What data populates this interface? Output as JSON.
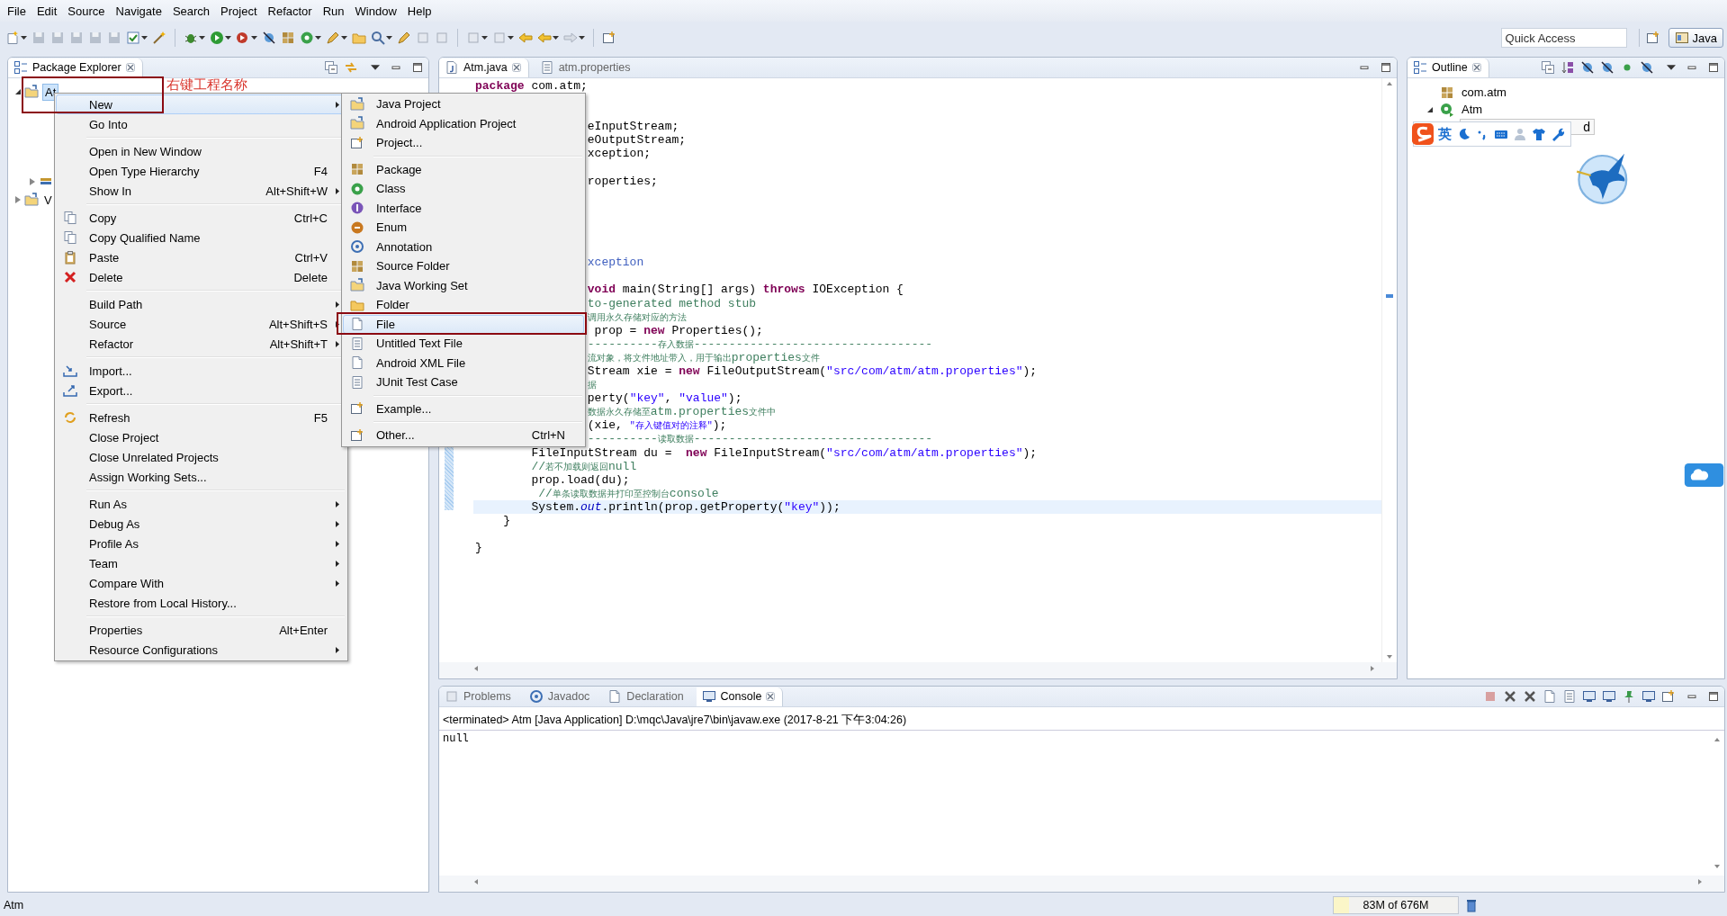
{
  "menubar": [
    "File",
    "Edit",
    "Source",
    "Navigate",
    "Search",
    "Project",
    "Refactor",
    "Run",
    "Window",
    "Help"
  ],
  "toolbar": {
    "quick_access": {
      "placeholder": "Quick Access"
    },
    "perspective": {
      "label": "Java",
      "selected": true
    }
  },
  "package_explorer": {
    "tab": {
      "label": "Package Explorer",
      "selected": true
    },
    "tree": [
      {
        "label": "At",
        "expanded": true,
        "selected": true,
        "children": [
          {
            "kind": "covered"
          },
          {
            "kind": "covered"
          },
          {
            "kind": "covered"
          },
          {
            "kind": "covered"
          },
          {
            "kind": "stub",
            "expanded": false
          }
        ]
      },
      {
        "label": "V",
        "expanded": false,
        "selected": false
      }
    ]
  },
  "editor": {
    "tabs": [
      {
        "label": "Atm.java",
        "selected": true,
        "closable": true
      },
      {
        "label": "atm.properties",
        "selected": false,
        "closable": false
      }
    ],
    "lines": [
      {
        "kind": "full",
        "current": false,
        "tokens": [
          {
            "kind": "kw",
            "text": "package"
          },
          {
            "kind": "p",
            "text": " com.atm;"
          }
        ]
      },
      {
        "kind": "blank",
        "current": false
      },
      {
        "kind": "blank",
        "current": false
      },
      {
        "kind": "partial",
        "current": false,
        "tokens": [
          {
            "kind": "p",
            "text": "eInputStream;"
          }
        ]
      },
      {
        "kind": "partial",
        "current": false,
        "tokens": [
          {
            "kind": "p",
            "text": "eOutputStream;"
          }
        ]
      },
      {
        "kind": "partial",
        "current": false,
        "tokens": [
          {
            "kind": "p",
            "text": "xception;"
          }
        ]
      },
      {
        "kind": "blank",
        "current": false
      },
      {
        "kind": "partial",
        "current": false,
        "tokens": [
          {
            "kind": "p",
            "text": "roperties;"
          }
        ]
      },
      {
        "kind": "blank",
        "current": false
      },
      {
        "kind": "blank",
        "current": false
      },
      {
        "kind": "blank",
        "current": false
      },
      {
        "kind": "blank",
        "current": false
      },
      {
        "kind": "blank",
        "current": false
      },
      {
        "kind": "partial",
        "current": false,
        "tokens": [
          {
            "kind": "doc",
            "text": "xception"
          }
        ]
      },
      {
        "kind": "blank",
        "current": false
      },
      {
        "kind": "partial",
        "current": false,
        "tokens": [
          {
            "kind": "kw",
            "text": "void"
          },
          {
            "kind": "p",
            "text": " main(String[] args) "
          },
          {
            "kind": "kw",
            "text": "throws"
          },
          {
            "kind": "p",
            "text": " IOException {"
          }
        ]
      },
      {
        "kind": "partial",
        "current": false,
        "tokens": [
          {
            "kind": "c",
            "text": "to-generated method stub"
          }
        ]
      },
      {
        "kind": "partial",
        "current": false,
        "tokens": [
          {
            "kind": "cs",
            "text": "调用永久存储对应的方法"
          }
        ]
      },
      {
        "kind": "partial",
        "current": false,
        "tokens": [
          {
            "kind": "p",
            "text": " prop = "
          },
          {
            "kind": "kw",
            "text": "new"
          },
          {
            "kind": "p",
            "text": " Properties();"
          }
        ]
      },
      {
        "kind": "partial",
        "current": false,
        "tokens": [
          {
            "kind": "c",
            "text": "----------"
          },
          {
            "kind": "cs",
            "text": "存入数据"
          },
          {
            "kind": "c",
            "text": "----------------------------------"
          }
        ]
      },
      {
        "kind": "partial",
        "current": false,
        "tokens": [
          {
            "kind": "cs",
            "text": "流对象，将文件地址带入，用于输出"
          },
          {
            "kind": "c",
            "text": "properties"
          },
          {
            "kind": "cs",
            "text": "文件"
          }
        ]
      },
      {
        "kind": "partial",
        "current": false,
        "tokens": [
          {
            "kind": "p",
            "text": "Stream xie = "
          },
          {
            "kind": "kw",
            "text": "new"
          },
          {
            "kind": "p",
            "text": " FileOutputStream("
          },
          {
            "kind": "s",
            "text": "\"src/com/atm/atm.properties\""
          },
          {
            "kind": "p",
            "text": ");"
          }
        ]
      },
      {
        "kind": "partial",
        "current": false,
        "tokens": [
          {
            "kind": "cs",
            "text": "据"
          }
        ]
      },
      {
        "kind": "partial",
        "current": false,
        "tokens": [
          {
            "kind": "p",
            "text": "perty("
          },
          {
            "kind": "s",
            "text": "\"key\""
          },
          {
            "kind": "p",
            "text": ", "
          },
          {
            "kind": "s",
            "text": "\"value\""
          },
          {
            "kind": "p",
            "text": ");"
          }
        ]
      },
      {
        "kind": "partial",
        "current": false,
        "tokens": [
          {
            "kind": "cs",
            "text": "数据永久存储至"
          },
          {
            "kind": "c",
            "text": "atm.properties"
          },
          {
            "kind": "cs",
            "text": "文件中"
          }
        ]
      },
      {
        "kind": "partial",
        "current": false,
        "tokens": [
          {
            "kind": "p",
            "text": "(xie, "
          },
          {
            "kind": "ss",
            "text": "\"存入键值对的注释\""
          },
          {
            "kind": "p",
            "text": ");"
          }
        ]
      },
      {
        "kind": "partial",
        "current": false,
        "tokens": [
          {
            "kind": "c",
            "text": "----------"
          },
          {
            "kind": "cs",
            "text": "读取数据"
          },
          {
            "kind": "c",
            "text": "----------------------------------"
          }
        ]
      },
      {
        "kind": "full",
        "current": false,
        "tokens": [
          {
            "kind": "p",
            "text": "        FileInputStream du =  "
          },
          {
            "kind": "kw",
            "text": "new"
          },
          {
            "kind": "p",
            "text": " FileInputStream("
          },
          {
            "kind": "s",
            "text": "\"src/com/atm/atm.properties\""
          },
          {
            "kind": "p",
            "text": ");"
          }
        ]
      },
      {
        "kind": "full",
        "current": false,
        "tokens": [
          {
            "kind": "c",
            "text": "        //"
          },
          {
            "kind": "cs",
            "text": "若不加载则返回"
          },
          {
            "kind": "c",
            "text": "null"
          }
        ]
      },
      {
        "kind": "full",
        "current": false,
        "tokens": [
          {
            "kind": "p",
            "text": "        prop.load(du);"
          }
        ]
      },
      {
        "kind": "full",
        "current": false,
        "tokens": [
          {
            "kind": "c",
            "text": "         //"
          },
          {
            "kind": "cs",
            "text": "单条读取数据并打印至控制台"
          },
          {
            "kind": "c",
            "text": "console"
          }
        ]
      },
      {
        "kind": "full",
        "current": true,
        "tokens": [
          {
            "kind": "p",
            "text": "        System."
          },
          {
            "kind": "f",
            "text": "out"
          },
          {
            "kind": "p",
            "text": ".println(prop.getProperty("
          },
          {
            "kind": "s",
            "text": "\"key\""
          },
          {
            "kind": "p",
            "text": "));"
          }
        ]
      },
      {
        "kind": "full",
        "current": false,
        "tokens": [
          {
            "kind": "p",
            "text": "    }"
          }
        ]
      },
      {
        "kind": "blank",
        "current": false
      },
      {
        "kind": "full",
        "current": false,
        "tokens": [
          {
            "kind": "p",
            "text": "}"
          }
        ]
      }
    ]
  },
  "outline": {
    "tab": {
      "label": "Outline",
      "selected": true
    },
    "items": [
      {
        "label": "com.atm",
        "expanded": false
      },
      {
        "label": "Atm",
        "expanded": true
      }
    ],
    "tooltip": "d"
  },
  "ime_bar": {
    "mode": "英"
  },
  "console": {
    "tabs": [
      {
        "label": "Problems",
        "selected": false
      },
      {
        "label": "Javadoc",
        "selected": false
      },
      {
        "label": "Declaration",
        "selected": false
      },
      {
        "label": "Console",
        "selected": true
      }
    ],
    "header": "<terminated> Atm [Java Application] D:\\mqc\\Java\\jre7\\bin\\javaw.exe (2017-8-21 下午3:04:26)",
    "output": "null"
  },
  "context_menu": {
    "groups": [
      {
        "items": [
          {
            "label": "New",
            "submenu": true,
            "selected": true
          },
          {
            "label": "Go Into",
            "submenu": false,
            "selected": false
          }
        ]
      },
      {
        "items": [
          {
            "label": "Open in New Window",
            "submenu": false,
            "selected": false
          },
          {
            "label": "Open Type Hierarchy",
            "shortcut": "F4",
            "submenu": false,
            "selected": false
          },
          {
            "label": "Show In",
            "shortcut": "Alt+Shift+W",
            "submenu": true,
            "selected": false
          }
        ]
      },
      {
        "items": [
          {
            "label": "Copy",
            "shortcut": "Ctrl+C",
            "submenu": false,
            "selected": false
          },
          {
            "label": "Copy Qualified Name",
            "submenu": false,
            "selected": false
          },
          {
            "label": "Paste",
            "shortcut": "Ctrl+V",
            "submenu": false,
            "selected": false
          },
          {
            "label": "Delete",
            "shortcut": "Delete",
            "submenu": false,
            "selected": false
          }
        ]
      },
      {
        "items": [
          {
            "label": "Build Path",
            "submenu": true,
            "selected": false
          },
          {
            "label": "Source",
            "shortcut": "Alt+Shift+S",
            "submenu": true,
            "selected": false
          },
          {
            "label": "Refactor",
            "shortcut": "Alt+Shift+T",
            "submenu": true,
            "selected": false
          }
        ]
      },
      {
        "items": [
          {
            "label": "Import...",
            "submenu": false,
            "selected": false
          },
          {
            "label": "Export...",
            "submenu": false,
            "selected": false
          }
        ]
      },
      {
        "items": [
          {
            "label": "Refresh",
            "shortcut": "F5",
            "submenu": false,
            "selected": false
          },
          {
            "label": "Close Project",
            "submenu": false,
            "selected": false
          },
          {
            "label": "Close Unrelated Projects",
            "submenu": false,
            "selected": false
          },
          {
            "label": "Assign Working Sets...",
            "submenu": false,
            "selected": false
          }
        ]
      },
      {
        "items": [
          {
            "label": "Run As",
            "submenu": true,
            "selected": false
          },
          {
            "label": "Debug As",
            "submenu": true,
            "selected": false
          },
          {
            "label": "Profile As",
            "submenu": true,
            "selected": false
          },
          {
            "label": "Team",
            "submenu": true,
            "selected": false
          },
          {
            "label": "Compare With",
            "submenu": true,
            "selected": false
          },
          {
            "label": "Restore from Local History...",
            "submenu": false,
            "selected": false
          }
        ]
      },
      {
        "items": [
          {
            "label": "Properties",
            "shortcut": "Alt+Enter",
            "submenu": false,
            "selected": false
          },
          {
            "label": "Resource Configurations",
            "submenu": true,
            "selected": false
          }
        ]
      }
    ]
  },
  "new_submenu": {
    "groups": [
      {
        "items": [
          {
            "label": "Java Project",
            "selected": false
          },
          {
            "label": "Android Application Project",
            "selected": false
          },
          {
            "label": "Project...",
            "selected": false
          }
        ]
      },
      {
        "items": [
          {
            "label": "Package",
            "selected": false
          },
          {
            "label": "Class",
            "selected": false
          },
          {
            "label": "Interface",
            "selected": false
          },
          {
            "label": "Enum",
            "selected": false
          },
          {
            "label": "Annotation",
            "selected": false
          },
          {
            "label": "Source Folder",
            "selected": false
          },
          {
            "label": "Java Working Set",
            "selected": false
          },
          {
            "label": "Folder",
            "selected": false
          },
          {
            "label": "File",
            "selected": true
          },
          {
            "label": "Untitled Text File",
            "selected": false
          },
          {
            "label": "Android XML File",
            "selected": false
          },
          {
            "label": "JUnit Test Case",
            "selected": false
          }
        ]
      },
      {
        "items": [
          {
            "label": "Example...",
            "selected": false
          }
        ]
      },
      {
        "items": [
          {
            "label": "Other...",
            "shortcut": "Ctrl+N",
            "selected": false
          }
        ]
      }
    ]
  },
  "annotation": {
    "label": "右键工程名称"
  },
  "status_bar": {
    "selection": "Atm",
    "heap": {
      "label": "83M of 676M",
      "level": 0.12
    }
  }
}
